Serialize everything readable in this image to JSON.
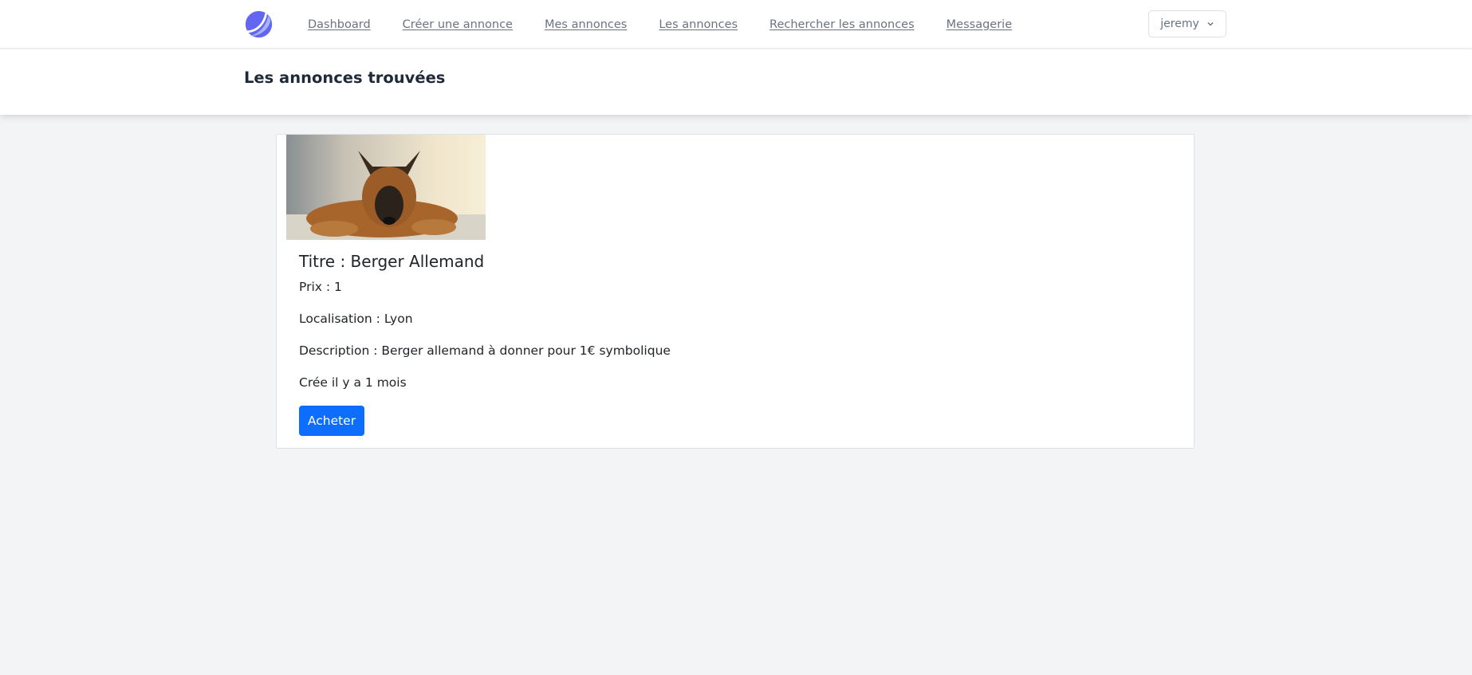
{
  "nav": {
    "links": [
      "Dashboard",
      "Créer une annonce",
      "Mes annonces",
      "Les annonces",
      "Rechercher les annonces",
      "Messagerie"
    ],
    "user": "jeremy"
  },
  "header": {
    "title": "Les annonces trouvées"
  },
  "listing": {
    "title": "Titre : Berger Allemand",
    "price": "Prix : 1",
    "location": "Localisation : Lyon",
    "description": "Description : Berger allemand à donner pour 1€ symbolique",
    "created": "Crée il y a 1 mois",
    "buy_label": "Acheter"
  },
  "colors": {
    "primary": "#0d6efd",
    "logo": "#6366f1"
  }
}
